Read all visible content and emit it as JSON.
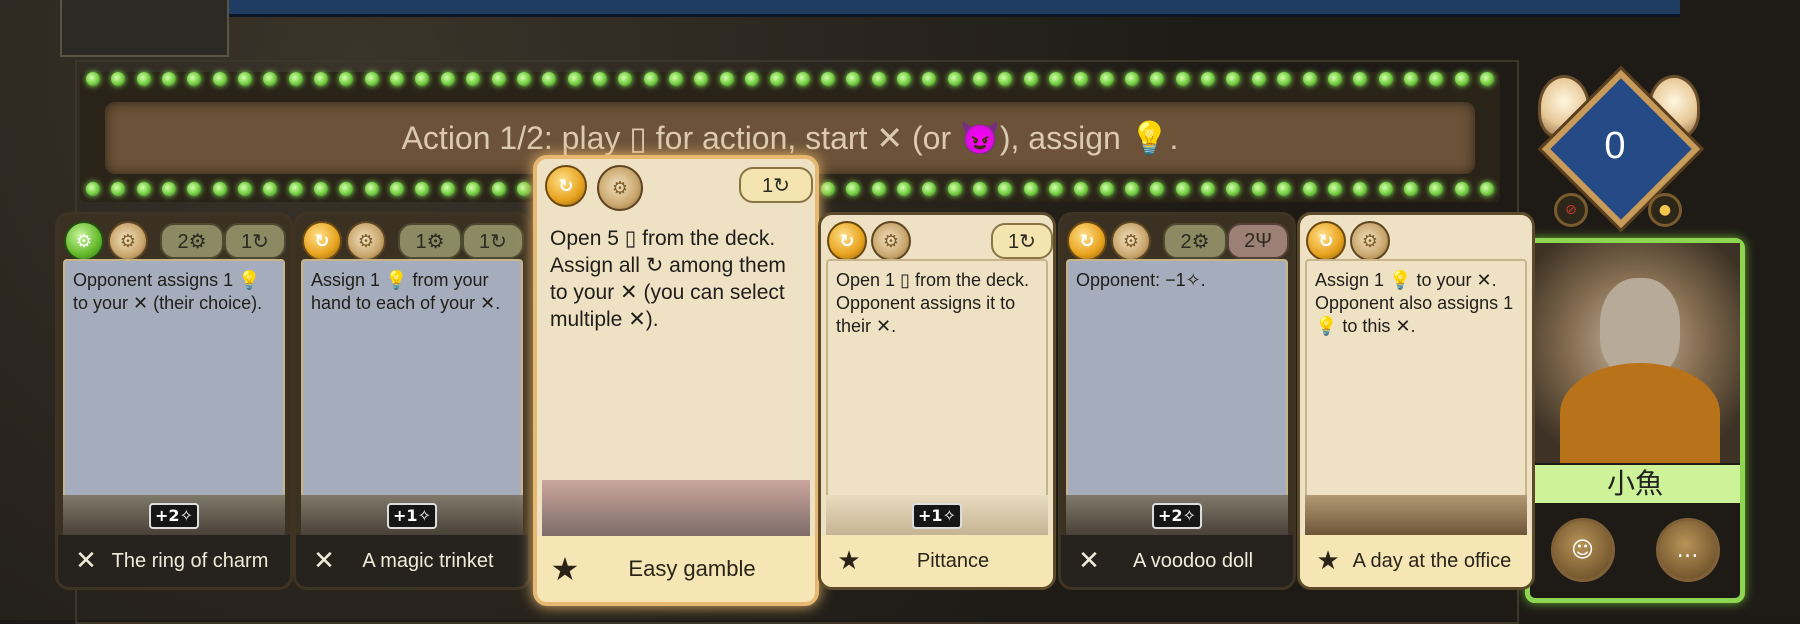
{
  "banner": {
    "text": "Action 1/2: play ▯ for action, start ✕ (or 😈), assign 💡."
  },
  "indicator": {
    "value": "0"
  },
  "player": {
    "name": "小魚"
  },
  "cards": [
    {
      "title": "The ring of charm",
      "type_icon": "✕",
      "top_coin": "⚙",
      "costs": [
        "2⚙",
        "1↻"
      ],
      "text": "Opponent assigns 1 💡 to your ✕ (their choice).",
      "tag": "+2✧"
    },
    {
      "title": "A magic trinket",
      "type_icon": "✕",
      "top_coin": "↻",
      "costs": [
        "1⚙",
        "1↻"
      ],
      "text": "Assign 1 💡 from your hand to each of your ✕.",
      "tag": "+1✧"
    },
    {
      "title": "Easy gamble",
      "type_icon": "★",
      "top_coin": "↻",
      "costs": [
        "1↻"
      ],
      "text": "Open 5 ▯ from the deck. Assign all ↻ among them to your ✕ (you can select multiple ✕).",
      "tag": ""
    },
    {
      "title": "Pittance",
      "type_icon": "★",
      "top_coin": "↻",
      "costs": [
        "1↻"
      ],
      "text": "Open 1 ▯ from the deck. Opponent assigns it to their ✕.",
      "tag": "+1✧"
    },
    {
      "title": "A voodoo doll",
      "type_icon": "✕",
      "top_coin": "↻",
      "costs": [
        "2⚙",
        "2Ψ"
      ],
      "text": "Opponent: −1✧.",
      "tag": "+2✧"
    },
    {
      "title": "A day at the office",
      "type_icon": "★",
      "top_coin": "↻",
      "costs": [],
      "text": "Assign 1 💡 to your ✕. Opponent also assigns 1 💡 to this ✕.",
      "tag": ""
    }
  ],
  "colors": {
    "accent_green": "#8ed651",
    "banner_brown": "#6b5238",
    "diamond_blue": "#264a86",
    "card_gold": "#e7a21d"
  },
  "icons": {
    "bulb": "lightbulb-icon",
    "gear": "gear-icon",
    "coin": "coin-icon",
    "crossed-tools": "crossed-tools-icon",
    "star": "star-icon",
    "emote": "goblin-emote-icon",
    "chat": "chat-emote-icon"
  }
}
